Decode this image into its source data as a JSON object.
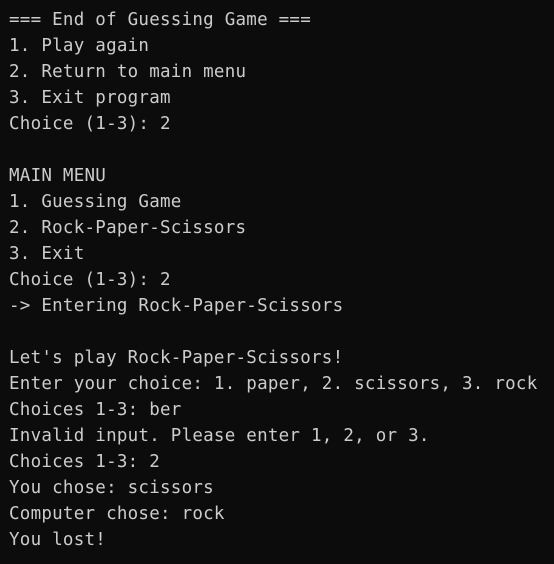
{
  "terminal": {
    "colors": {
      "background": "#0c0c0c",
      "text": "#cccccc"
    },
    "lines": [
      "=== End of Guessing Game ===",
      "1. Play again",
      "2. Return to main menu",
      "3. Exit program",
      "Choice (1-3): 2",
      "",
      "MAIN MENU",
      "1. Guessing Game",
      "2. Rock-Paper-Scissors",
      "3. Exit",
      "Choice (1-3): 2",
      "-> Entering Rock-Paper-Scissors",
      "",
      "Let's play Rock-Paper-Scissors!",
      "Enter your choice: 1. paper, 2. scissors, 3. rock",
      "Choices 1-3: ber",
      "Invalid input. Please enter 1, 2, or 3.",
      "Choices 1-3: 2",
      "You chose: scissors",
      "Computer chose: rock",
      "You lost!"
    ]
  }
}
